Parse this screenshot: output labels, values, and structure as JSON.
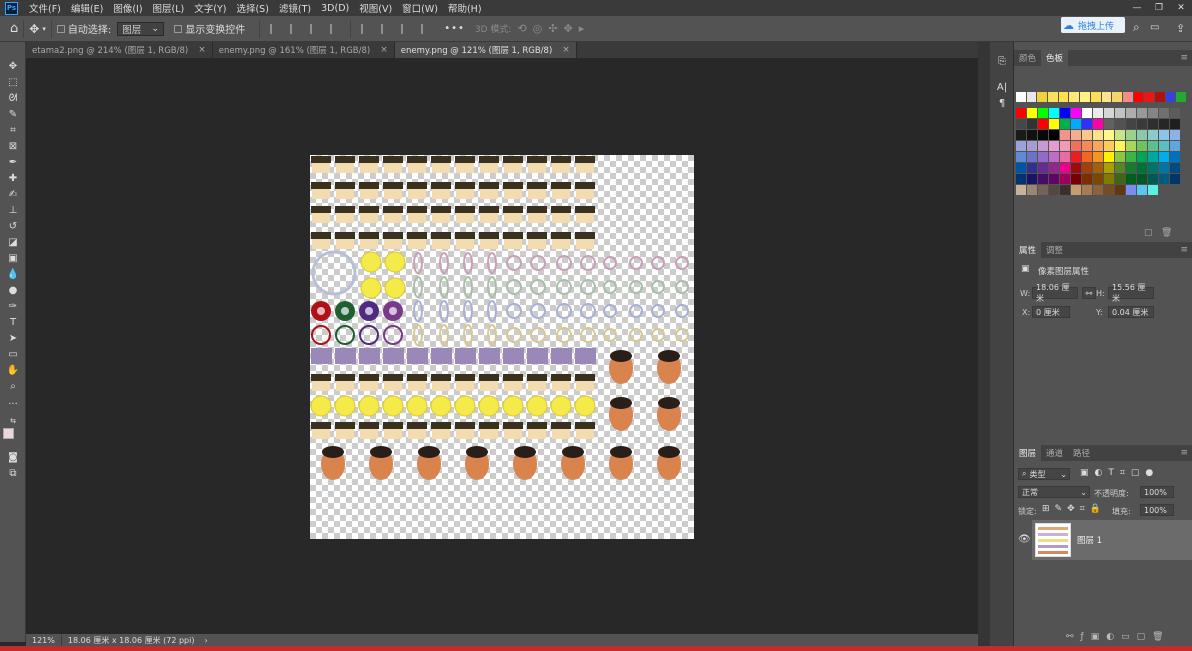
{
  "app": {
    "logo": "Ps"
  },
  "menu": [
    "文件(F)",
    "编辑(E)",
    "图像(I)",
    "图层(L)",
    "文字(Y)",
    "选择(S)",
    "滤镜(T)",
    "3D(D)",
    "视图(V)",
    "窗口(W)",
    "帮助(H)"
  ],
  "window_controls": [
    "—",
    "❐",
    "✕"
  ],
  "options": {
    "auto_select_label": "自动选择:",
    "auto_select_value": "图层",
    "show_transform_label": "显示变换控件",
    "three_d_mode_label": "3D 模式:",
    "more": "•••"
  },
  "upload": {
    "label": "拖拽上传"
  },
  "tabs": [
    {
      "label": "etama2.png @ 214% (图层 1, RGB/8)",
      "close": "×"
    },
    {
      "label": "enemy.png @ 161% (图层 1, RGB/8)",
      "close": "×"
    },
    {
      "label": "enemy.png @ 121% (图层 1, RGB/8)",
      "close": "×",
      "active": true
    }
  ],
  "status": {
    "zoom": "121%",
    "doc_info": "18.06 厘米 x 18.06 厘米 (72 ppi)",
    "arrow": "›"
  },
  "color_panel": {
    "tabs": [
      "颜色",
      "色板"
    ],
    "active": "色板"
  },
  "properties_panel": {
    "tabs": [
      "属性",
      "调整"
    ],
    "title": "像素图层属性",
    "w_label": "W:",
    "w_value": "18.06 厘米",
    "link_icon": "⚯",
    "h_label": "H:",
    "h_value": "15.56 厘米",
    "x_label": "X:",
    "x_value": "0 厘米",
    "y_label": "Y:",
    "y_value": "0.04 厘米"
  },
  "layers_panel": {
    "tabs": [
      "图层",
      "通道",
      "路径"
    ],
    "filter_kind": "类型",
    "blend_mode": "正常",
    "opacity_label": "不透明度:",
    "opacity_value": "100%",
    "lock_label": "锁定:",
    "fill_label": "填充:",
    "fill_value": "100%",
    "layer_name": "图层 1"
  },
  "colors": {
    "swatch_rows": [
      [
        "#ffffff",
        "#e8e8e8",
        "#f2d23a",
        "#f7e05a",
        "#ffe14d",
        "#ffe876",
        "#fff27e",
        "#ffdd58",
        "#ffe28a",
        "#f5d46a",
        "#f08c8c",
        "#ff0000",
        "#e51919",
        "#b01010",
        "#3344dd",
        "#22aa33"
      ],
      [
        "#ff0000",
        "#ffff00",
        "#00ff00",
        "#00ffff",
        "#0000ff",
        "#ff00ff",
        "#ffffff",
        "#ebebeb",
        "#d6d6d6",
        "#c2c2c2",
        "#adadad",
        "#999999",
        "#858585",
        "#707070",
        "#5c5c5c"
      ],
      [
        "#474747",
        "#333333",
        "#ff0000",
        "#ffff00",
        "#00b050",
        "#00aaff",
        "#3030ff",
        "#ff00aa",
        "#616161",
        "#525252",
        "#444444",
        "#3a3a3a",
        "#2f2f2f",
        "#262626",
        "#1f1f1f"
      ],
      [
        "#1a1a1a",
        "#111111",
        "#080808",
        "#000000",
        "#f2948c",
        "#f5ad8c",
        "#f9c78c",
        "#fde28c",
        "#fff68c",
        "#c9e38c",
        "#9ad28c",
        "#8ccaa6",
        "#8ccbcc",
        "#8cc3e8",
        "#8cb2e8"
      ],
      [
        "#9aa2d9",
        "#a89ad2",
        "#c59ad2",
        "#e59ad2",
        "#f29ab2",
        "#f26f5c",
        "#f6895c",
        "#fba45c",
        "#ffca5c",
        "#fff45c",
        "#a8d65c",
        "#6dc45c",
        "#5cbf8c",
        "#5cbfbf",
        "#5ca7e0"
      ],
      [
        "#5c8cd6",
        "#6c72c6",
        "#8f6cc6",
        "#c06cc6",
        "#e86ca2",
        "#ee1c24",
        "#f26522",
        "#f7941d",
        "#fff200",
        "#8dc63f",
        "#39b54a",
        "#00a651",
        "#00a99d",
        "#00aeef",
        "#0072bc"
      ],
      [
        "#0054a6",
        "#2e3192",
        "#662d91",
        "#92278f",
        "#ec008c",
        "#9e0b0f",
        "#a0410d",
        "#a36209",
        "#aba000",
        "#598527",
        "#197b30",
        "#007236",
        "#00746b",
        "#0076a3",
        "#004b80"
      ],
      [
        "#003471",
        "#1b1464",
        "#440e62",
        "#630460",
        "#9e005d",
        "#790000",
        "#7b2e00",
        "#7d4900",
        "#827b00",
        "#406618",
        "#005e20",
        "#005826",
        "#005952",
        "#005b7f",
        "#003663"
      ],
      [
        "#c7b299",
        "#998675",
        "#736357",
        "#534741",
        "#37302d",
        "#c69c6d",
        "#a67c52",
        "#8c6239",
        "#754c24",
        "#603913",
        "#7b8cf0",
        "#5cc4f0",
        "#5cf0e0"
      ]
    ]
  }
}
